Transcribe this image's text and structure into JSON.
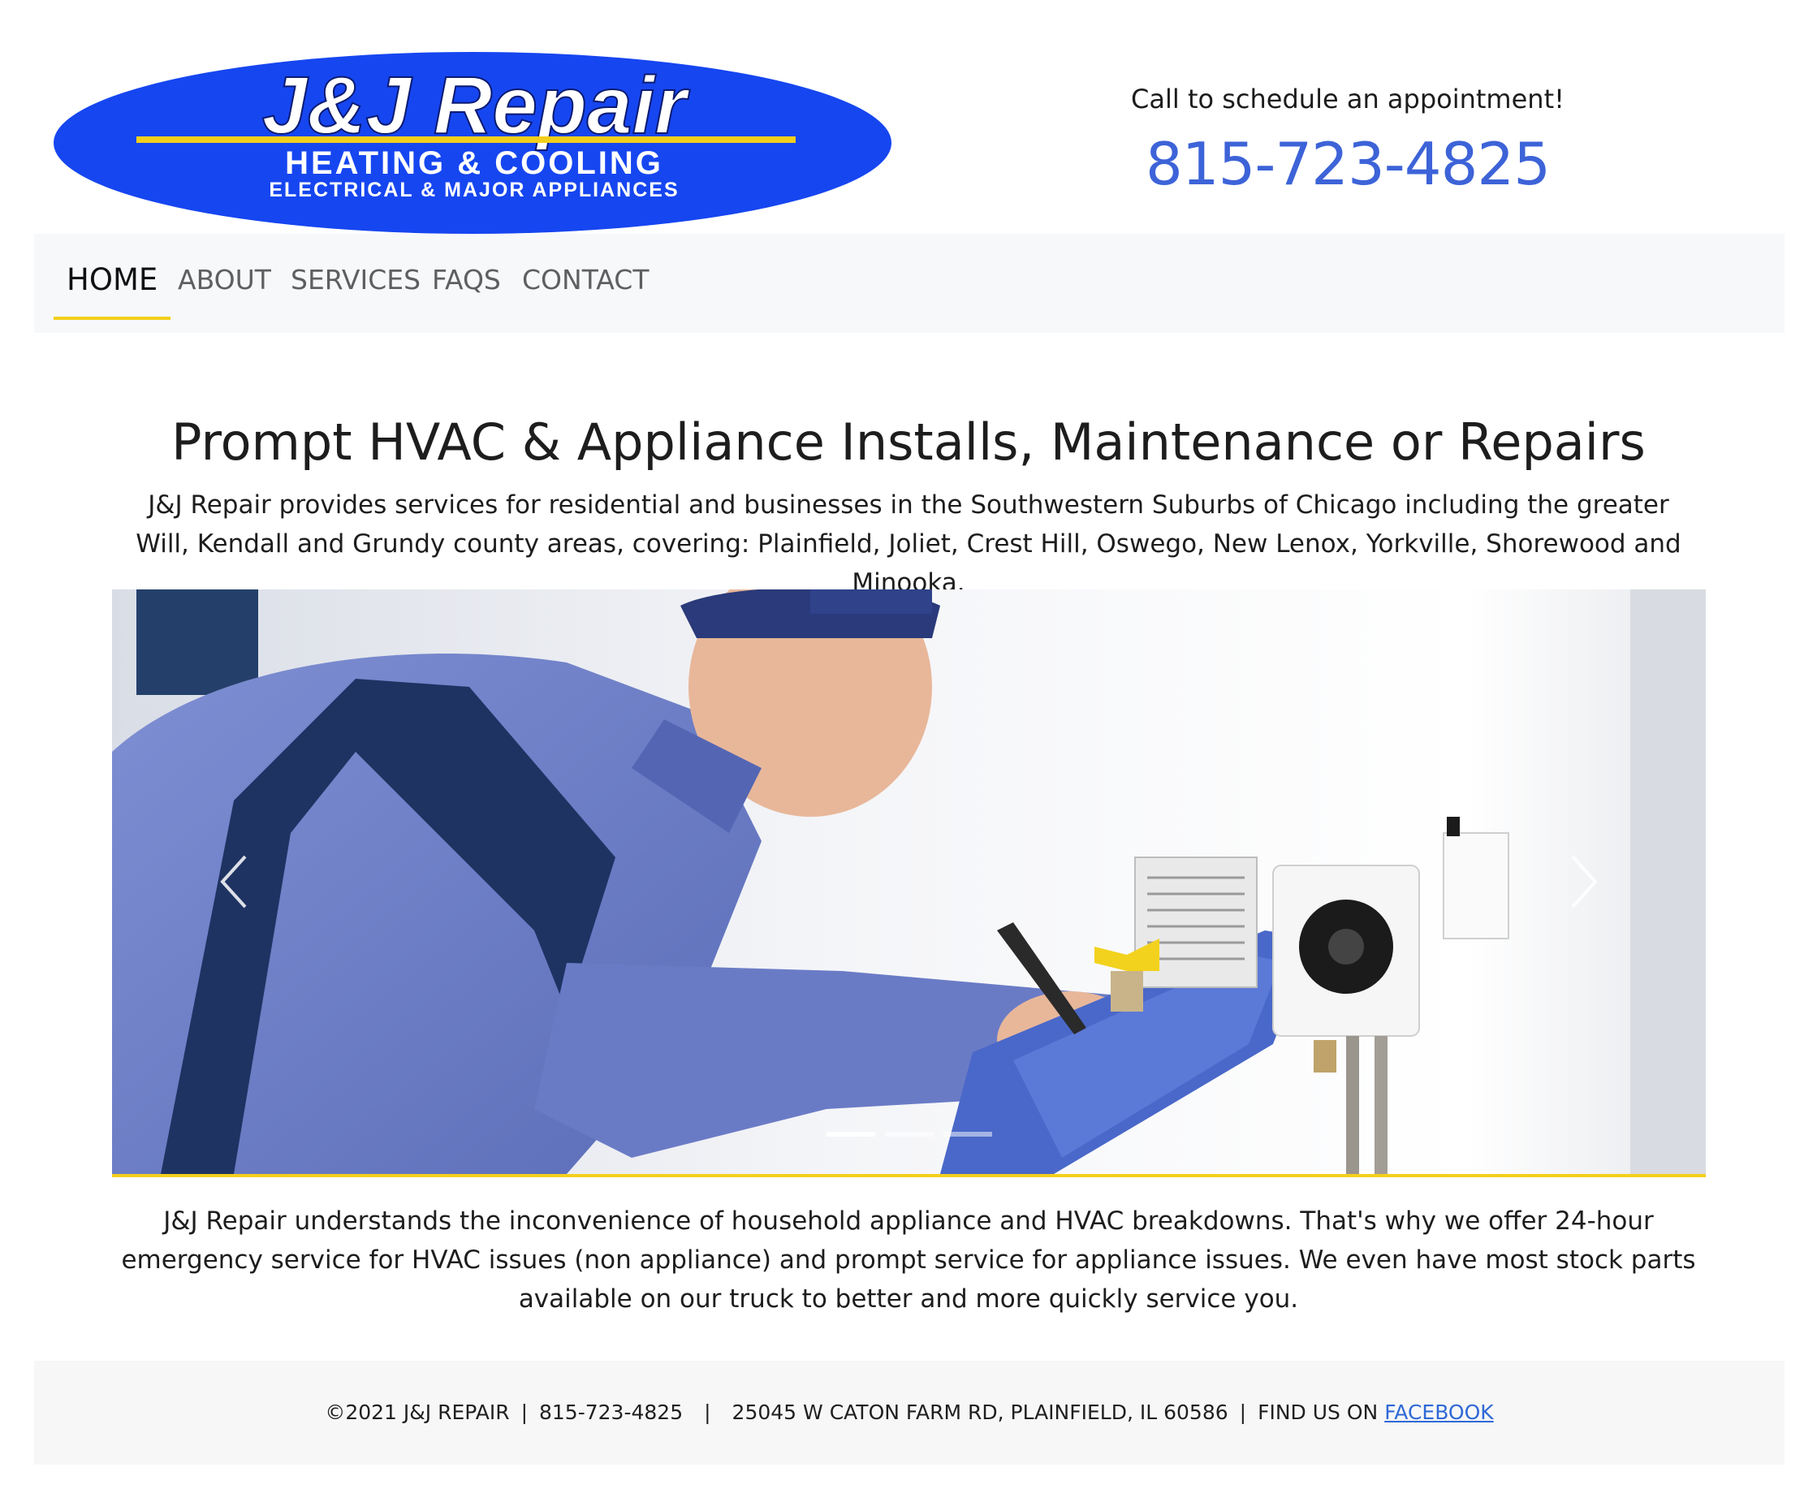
{
  "logo": {
    "brand": "J&J Repair",
    "line1": "HEATING & COOLING",
    "line2": "ELECTRICAL & MAJOR APPLIANCES"
  },
  "header": {
    "cta_text": "Call to schedule an appointment!",
    "phone": "815-723-4825"
  },
  "nav": {
    "items": [
      {
        "label": "HOME",
        "active": true
      },
      {
        "label": "ABOUT",
        "active": false
      },
      {
        "label": "SERVICES",
        "active": false
      },
      {
        "label": "FAQS",
        "active": false
      },
      {
        "label": "CONTACT",
        "active": false
      }
    ]
  },
  "main": {
    "headline": "Prompt HVAC & Appliance Installs, Maintenance or Repairs",
    "intro": "J&J Repair provides services for residential and businesses in the Southwestern Suburbs of Chicago including the greater Will, Kendall and Grundy county areas, covering: Plainfield, Joliet, Crest Hill, Oswego, New Lenox, Yorkville, Shorewood and Minooka.",
    "body": "J&J Repair understands the inconvenience of household appliance and HVAC breakdowns. That's why we offer 24-hour emergency service for HVAC issues (non appliance) and prompt service for appliance issues. We even have most stock parts available on our truck to better and more quickly service you."
  },
  "carousel": {
    "slide_count": 3,
    "active_index": 0,
    "prev_icon": "chevron-left-icon",
    "next_icon": "chevron-right-icon"
  },
  "footer": {
    "copyright": "©2021 J&J REPAIR",
    "phone": "815-723-4825",
    "address": "25045 W CATON FARM RD, PLAINFIELD, IL 60586",
    "find_us": "FIND US ON",
    "facebook": "FACEBOOK"
  },
  "colors": {
    "accent_yellow": "#f3cf1c",
    "phone_blue": "#3d63d8",
    "logo_blue": "#1646f0",
    "link_blue": "#2f69d6"
  }
}
